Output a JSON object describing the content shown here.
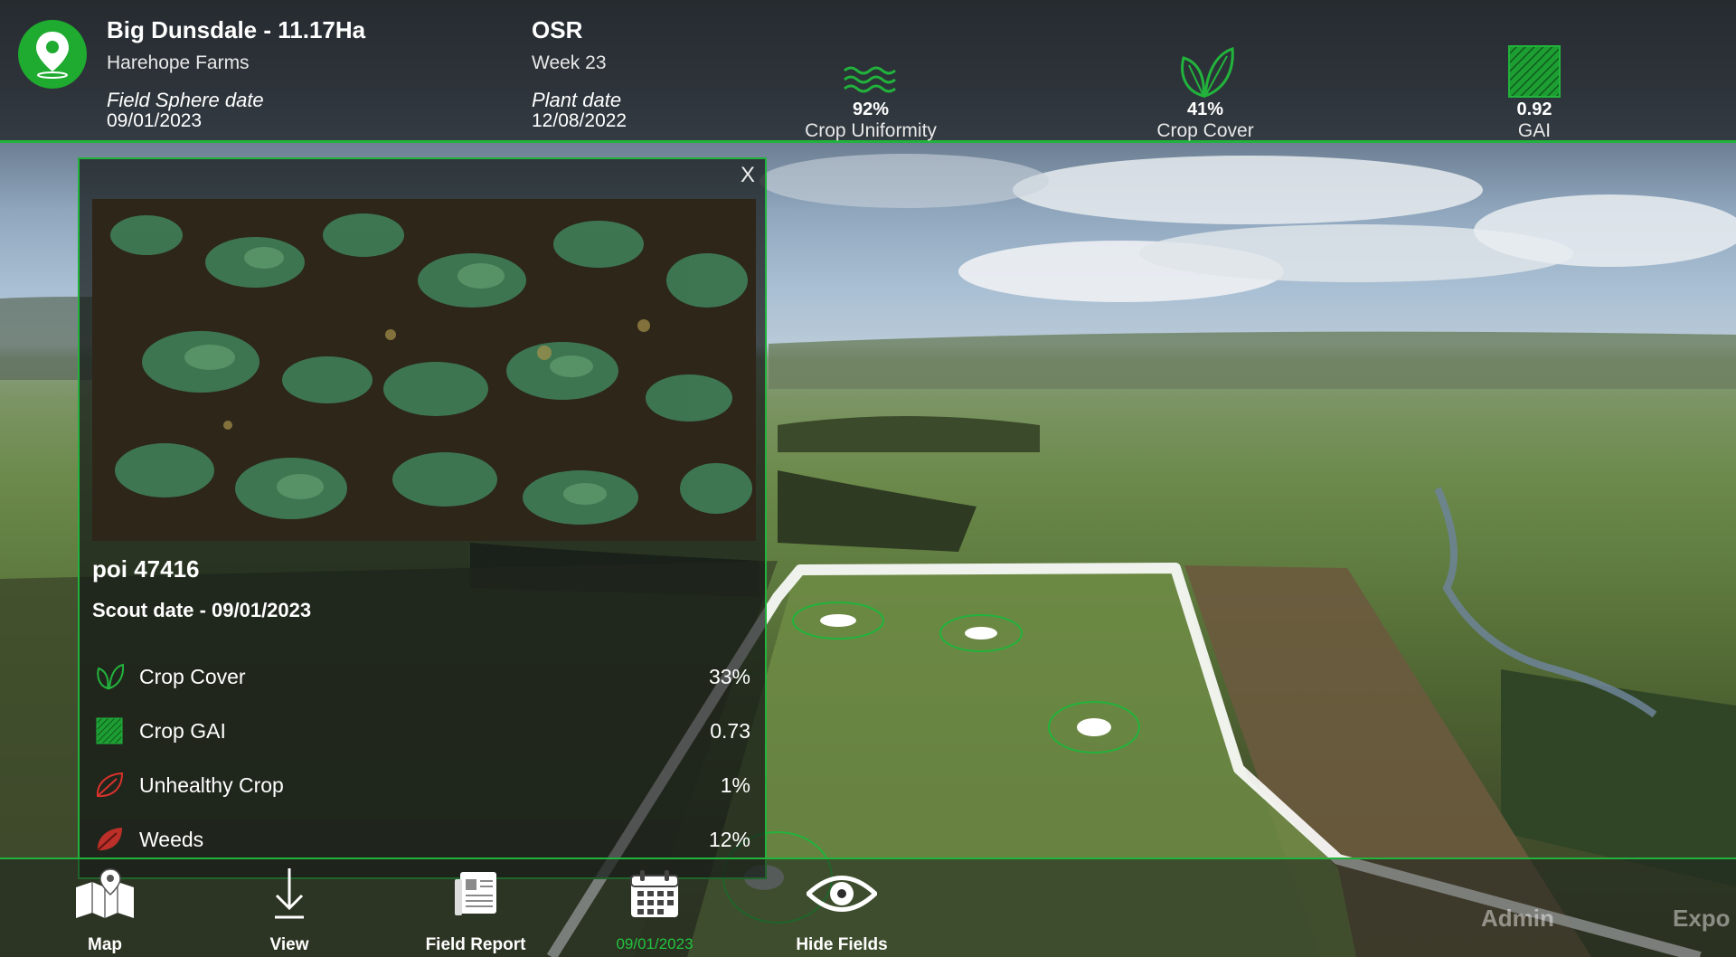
{
  "header": {
    "field_title": "Big Dunsdale - 11.17Ha",
    "farm_name": "Harehope Farms",
    "sphere_date_label": "Field Sphere date",
    "sphere_date": "09/01/2023",
    "crop": "OSR",
    "week": "Week 23",
    "plant_date_label": "Plant date",
    "plant_date": "12/08/2022",
    "metrics": [
      {
        "icon": "wave-icon",
        "value": "92%",
        "label": "Crop Uniformity"
      },
      {
        "icon": "leaf-icon",
        "value": "41%",
        "label": "Crop Cover"
      },
      {
        "icon": "gai-hatch-icon",
        "value": "0.92",
        "label": "GAI"
      }
    ]
  },
  "popup": {
    "close_label": "X",
    "poi_title": "poi 47416",
    "scout_date": "Scout date - 09/01/2023",
    "stats": [
      {
        "icon": "leaf-outline-green-icon",
        "label": "Crop Cover",
        "value": "33%"
      },
      {
        "icon": "gai-hatch-icon",
        "label": "Crop GAI",
        "value": "0.73"
      },
      {
        "icon": "leaf-outline-red-icon",
        "label": "Unhealthy Crop",
        "value": "1%"
      },
      {
        "icon": "weed-leaf-red-icon",
        "label": "Weeds",
        "value": "12%"
      }
    ]
  },
  "toolbar": {
    "map": "Map",
    "view": "View",
    "field_report": "Field Report",
    "date": "09/01/2023",
    "hide_fields": "Hide Fields",
    "admin": "Admin",
    "export": "Expo"
  },
  "colors": {
    "accent_green": "#22b33c",
    "alert_red": "#d8322b"
  }
}
